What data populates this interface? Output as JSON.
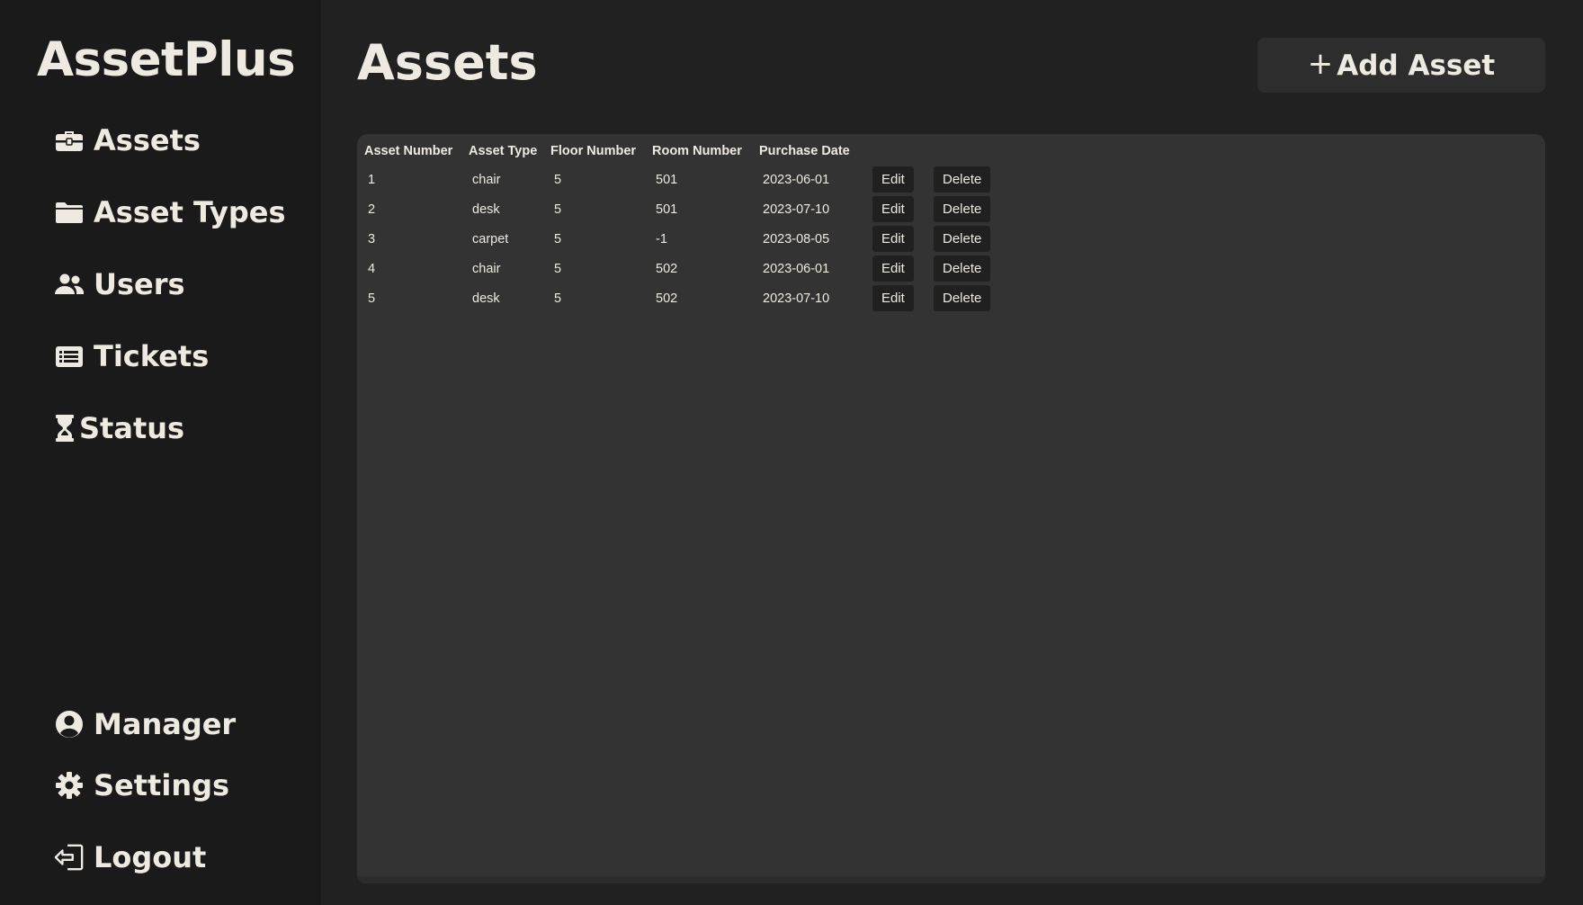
{
  "app": {
    "name": "AssetPlus"
  },
  "sidebar": {
    "top_items": [
      {
        "label": "Assets",
        "icon": "toolbox-icon"
      },
      {
        "label": "Asset Types",
        "icon": "folder-icon"
      },
      {
        "label": "Users",
        "icon": "users-icon"
      },
      {
        "label": "Tickets",
        "icon": "tickets-icon"
      },
      {
        "label": "Status",
        "icon": "hourglass-icon"
      }
    ],
    "bottom_items": [
      {
        "label": "Manager",
        "icon": "user-circle-icon"
      },
      {
        "label": "Settings",
        "icon": "gear-icon"
      },
      {
        "label": "Logout",
        "icon": "logout-icon"
      }
    ]
  },
  "header": {
    "title": "Assets",
    "add_button": {
      "plus": "+",
      "label": "Add Asset"
    }
  },
  "table": {
    "columns": [
      "Asset Number",
      "Asset Type",
      "Floor Number",
      "Room Number",
      "Purchase Date"
    ],
    "actions": {
      "edit": "Edit",
      "delete": "Delete"
    },
    "rows": [
      {
        "asset_number": "1",
        "asset_type": "chair",
        "floor": "5",
        "room": "501",
        "date": "2023-06-01"
      },
      {
        "asset_number": "2",
        "asset_type": "desk",
        "floor": "5",
        "room": "501",
        "date": "2023-07-10"
      },
      {
        "asset_number": "3",
        "asset_type": "carpet",
        "floor": "5",
        "room": "-1",
        "date": "2023-08-05"
      },
      {
        "asset_number": "4",
        "asset_type": "chair",
        "floor": "5",
        "room": "502",
        "date": "2023-06-01"
      },
      {
        "asset_number": "5",
        "asset_type": "desk",
        "floor": "5",
        "room": "502",
        "date": "2023-07-10"
      }
    ]
  },
  "colors": {
    "background": "#212121",
    "sidebar": "#1a1a1a",
    "panel": "#333333",
    "button": "#2d2d2d",
    "text": "#eeeae2"
  }
}
